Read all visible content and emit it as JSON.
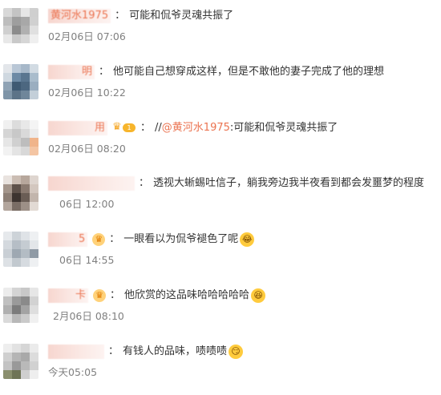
{
  "comments": [
    {
      "username": "黄河水1975",
      "text": "可能和侃爷灵魂共振了",
      "time": "02月06日 07:06"
    },
    {
      "username": "明",
      "text": "他可能自己想穿成这样，但是不敢他的妻子完成了他的理想",
      "time": "02月06日 10:22"
    },
    {
      "username": "用",
      "badge_level": "1",
      "reply_prefix": "//",
      "mention": "@黄河水1975",
      "text": ":可能和侃爷灵魂共振了",
      "time": "02月06日 08:20"
    },
    {
      "username": "",
      "text": "透视大蜥蜴吐信子，躺我旁边我半夜看到都会发噩梦的程度",
      "time": "06日 12:00"
    },
    {
      "username": "5",
      "text": "一眼看以为侃爷褪色了呢",
      "time": "06日 14:55"
    },
    {
      "username": "卡",
      "text": "他欣赏的这品味哈哈哈哈哈",
      "time": "2月06日 08:10"
    },
    {
      "username": "",
      "text": "有钱人的品味，啧啧啧",
      "time": "今天05:05"
    }
  ],
  "separator": "：",
  "icons": {
    "vip_badge": "crown-level-icon",
    "crown_badge": "crown-icon",
    "emoji_laugh_tears": "laughing-tears-emoji",
    "emoji_laugh": "laughing-emoji",
    "emoji_smirk": "smirk-emoji"
  },
  "colors": {
    "username": "#eb7350",
    "text": "#333333",
    "time": "#808080"
  }
}
